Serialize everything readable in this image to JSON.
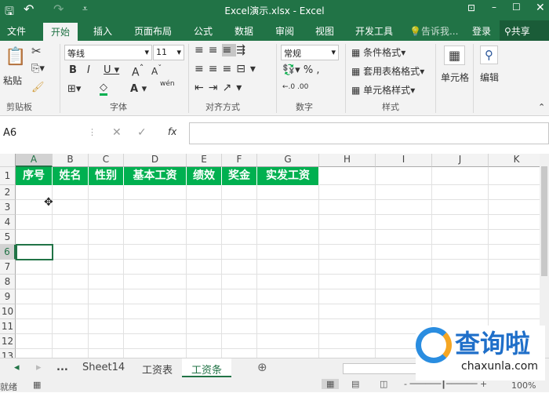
{
  "title": "Excel演示.xlsx - Excel",
  "tabs": [
    "文件",
    "开始",
    "插入",
    "页面布局",
    "公式",
    "数据",
    "审阅",
    "视图",
    "开发工具"
  ],
  "tell_me": "告诉我...",
  "login": "登录",
  "share": "共享",
  "ribbon": {
    "paste": "粘贴",
    "clipboard": "剪贴板",
    "font_name": "等线",
    "font_size": "11",
    "font_group": "字体",
    "align_group": "对齐方式",
    "number_format": "常规",
    "number_group": "数字",
    "cond_format": "条件格式",
    "table_format": "套用表格格式",
    "cell_style": "单元格样式",
    "styles_group": "样式",
    "cells": "单元格",
    "edit": "编辑",
    "wen": "wén"
  },
  "name_box": "A6",
  "fx": "fx",
  "columns": [
    "A",
    "B",
    "C",
    "D",
    "E",
    "F",
    "G",
    "H",
    "I",
    "J",
    "K"
  ],
  "rows": [
    "1",
    "2",
    "3",
    "4",
    "5",
    "6",
    "7",
    "8",
    "9",
    "10",
    "11",
    "12",
    "13"
  ],
  "headers": [
    "序号",
    "姓名",
    "性别",
    "基本工资",
    "绩效",
    "奖金",
    "实发工资"
  ],
  "sheets": [
    "Sheet14",
    "工资表",
    "工资条"
  ],
  "active_sheet": "工资条",
  "more": "...",
  "status": "就绪",
  "zoom": "100%",
  "watermark": {
    "name": "查询啦",
    "site": "chaxunla.com"
  },
  "colors": {
    "green": "#217346",
    "header_fill": "#00b050"
  }
}
